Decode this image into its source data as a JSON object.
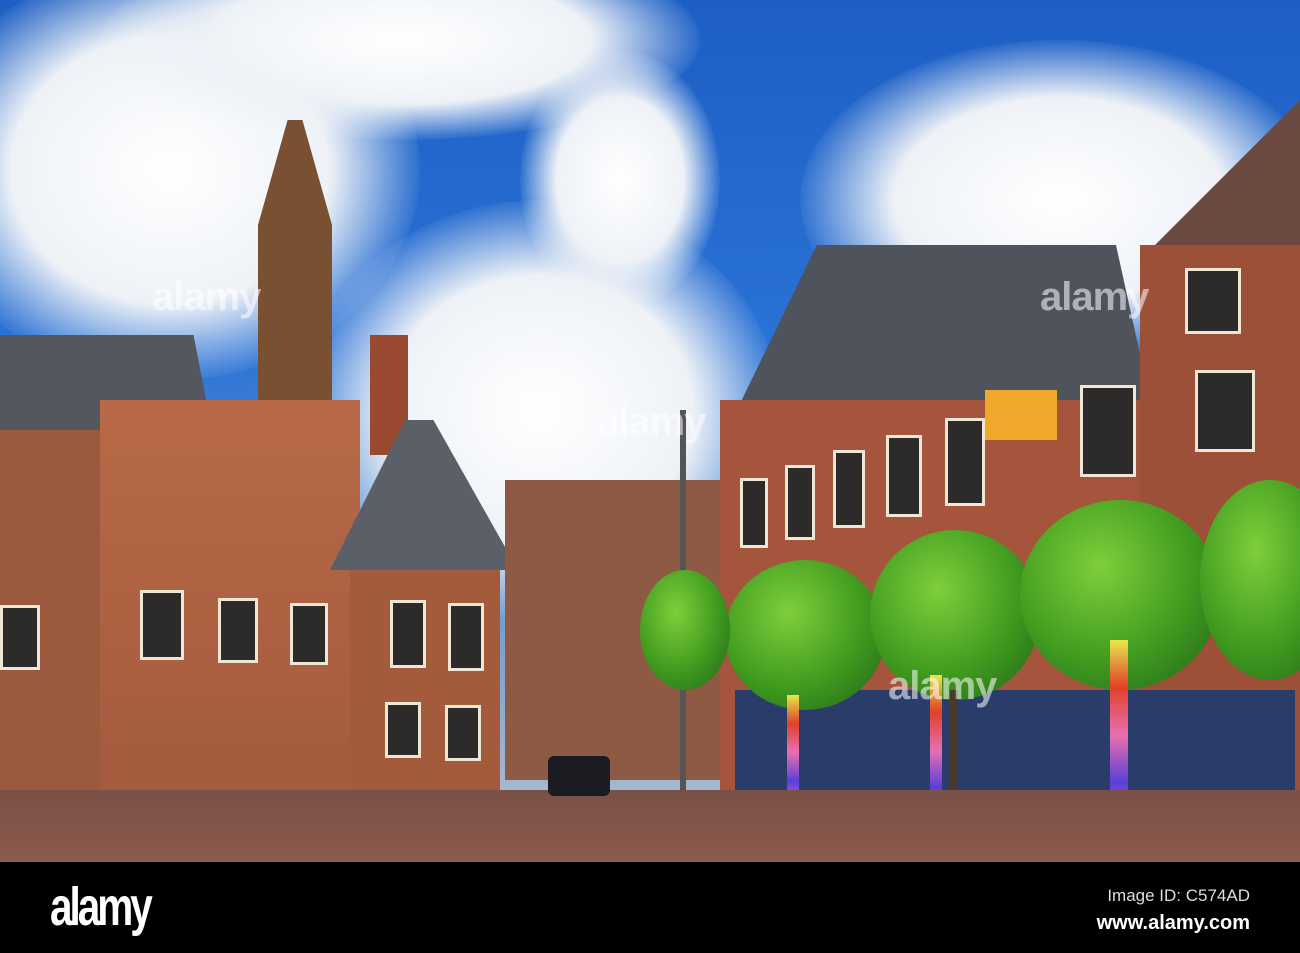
{
  "photo": {
    "subject": "town square with historic brick buildings and tower"
  },
  "watermark": {
    "text": "alamy"
  },
  "footer": {
    "logo": "alamy",
    "image_id": "Image ID: C574AD",
    "website": "www.alamy.com"
  }
}
